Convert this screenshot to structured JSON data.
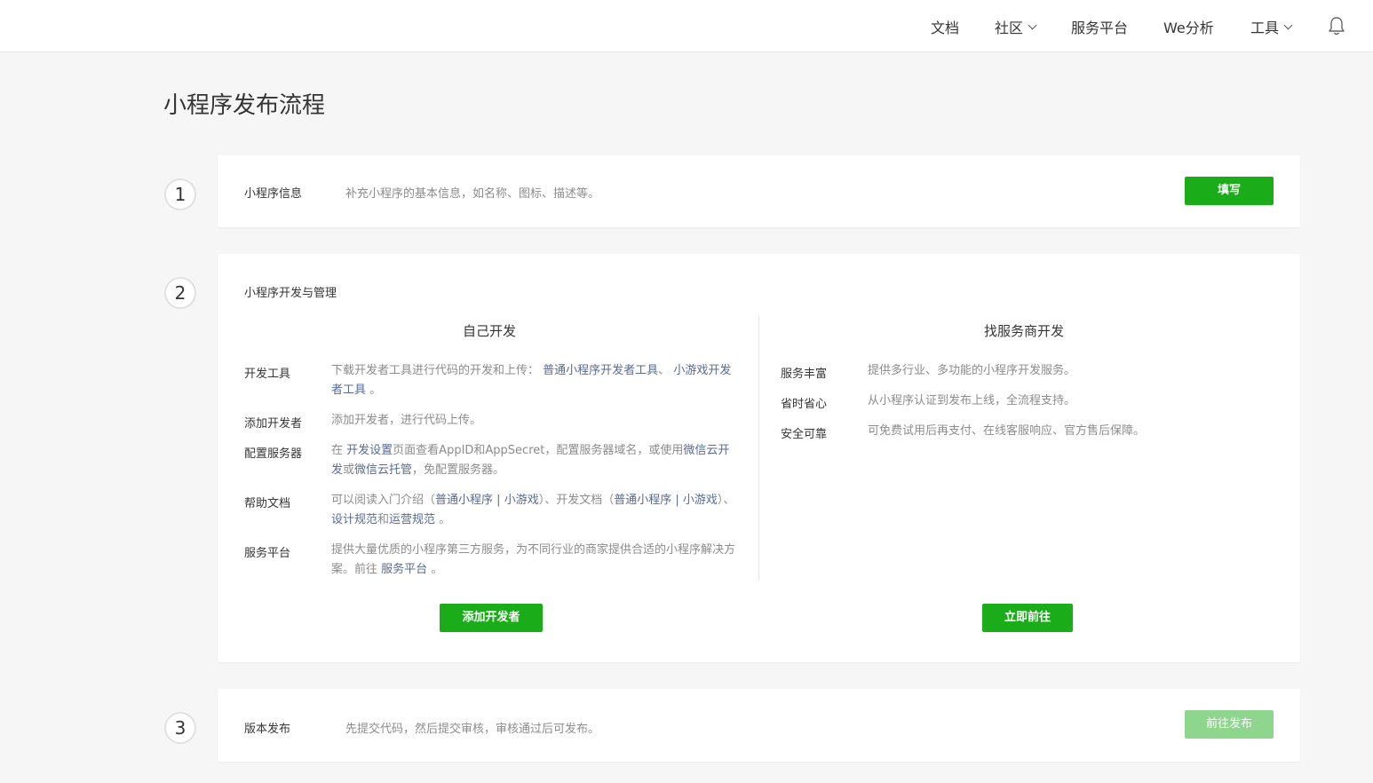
{
  "nav": {
    "docs": "文档",
    "community": "社区",
    "service_platform": "服务平台",
    "we_analytics": "We分析",
    "tools": "工具"
  },
  "page": {
    "title": "小程序发布流程"
  },
  "step1": {
    "number": "1",
    "title": "小程序信息",
    "desc": "补充小程序的基本信息，如名称、图标、描述等。",
    "button": "填写"
  },
  "step2": {
    "number": "2",
    "title": "小程序开发与管理",
    "self_dev": {
      "heading": "自己开发",
      "tools": {
        "label": "开发工具",
        "text1": "下载开发者工具进行代码的开发和上传：",
        "link1": "普通小程序开发者工具",
        "sep": "、",
        "link2": "小游戏开发者工具",
        "end": "。"
      },
      "add_dev": {
        "label": "添加开发者",
        "text": "添加开发者，进行代码上传。"
      },
      "server": {
        "label": "配置服务器",
        "t1": "在",
        "link1": "开发设置",
        "t2": "页面查看AppID和AppSecret，配置服务器域名，或使用",
        "link2": "微信云开发",
        "t3": "或",
        "link3": "微信云托管",
        "t4": "，免配置服务器。"
      },
      "help": {
        "label": "帮助文档",
        "t1": "可以阅读入门介绍（",
        "link1": "普通小程序",
        "bar1": " | ",
        "link2": "小游戏",
        "t2": "）、开发文档（",
        "link3": "普通小程序",
        "bar2": " | ",
        "link4": "小游戏",
        "t3": "）、",
        "link5": "设计规范",
        "t4": "和",
        "link6": "运营规范",
        "t5": "。"
      },
      "platform": {
        "label": "服务平台",
        "t1": "提供大量优质的小程序第三方服务，为不同行业的商家提供合适的小程序解决方案。前往",
        "link": "服务平台",
        "t2": "。"
      },
      "button": "添加开发者"
    },
    "provider_dev": {
      "heading": "找服务商开发",
      "rows": [
        {
          "label": "服务丰富",
          "text": "提供多行业、多功能的小程序开发服务。"
        },
        {
          "label": "省时省心",
          "text": "从小程序认证到发布上线，全流程支持。"
        },
        {
          "label": "安全可靠",
          "text": "可免费试用后再支付、在线客服响应、官方售后保障。"
        }
      ],
      "button": "立即前往"
    }
  },
  "step3": {
    "number": "3",
    "title": "版本发布",
    "desc": "先提交代码，然后提交审核，审核通过后可发布。",
    "button": "前往发布"
  },
  "colors": {
    "primary": "#1aad19",
    "link": "#576b95",
    "disabled": "#8ed68d"
  }
}
